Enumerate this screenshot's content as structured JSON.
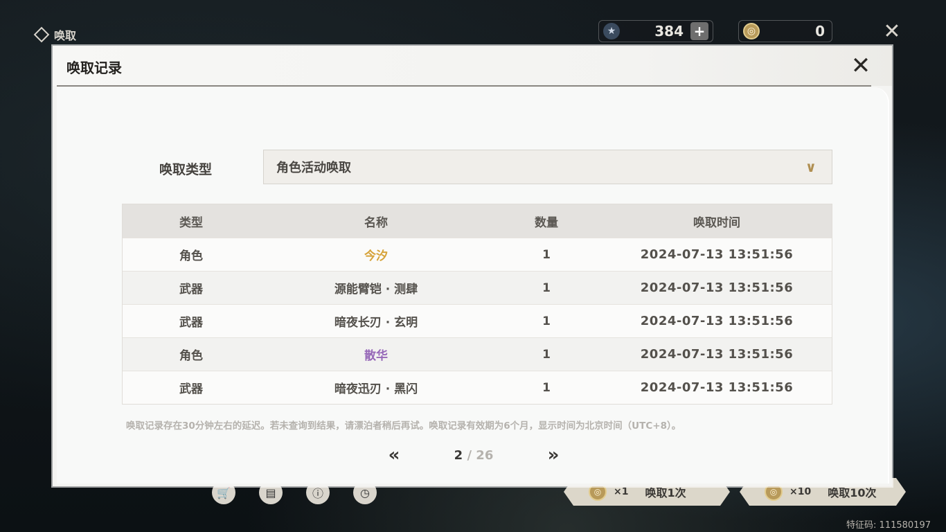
{
  "topbar": {
    "title": "唤取",
    "currency_star_value": "384",
    "currency_coin_value": "0"
  },
  "modal": {
    "title": "唤取记录",
    "filter_label": "唤取类型",
    "filter_selected": "角色活动唤取",
    "columns": [
      "类型",
      "名称",
      "数量",
      "唤取时间"
    ],
    "rows": [
      {
        "type": "角色",
        "name": "今汐",
        "qty": "1",
        "time": "2024-07-13 13:51:56",
        "quality": "gold"
      },
      {
        "type": "武器",
        "name": "源能臂铠 · 测肆",
        "qty": "1",
        "time": "2024-07-13 13:51:56",
        "quality": "normal"
      },
      {
        "type": "武器",
        "name": "暗夜长刃 · 玄明",
        "qty": "1",
        "time": "2024-07-13 13:51:56",
        "quality": "normal"
      },
      {
        "type": "角色",
        "name": "散华",
        "qty": "1",
        "time": "2024-07-13 13:51:56",
        "quality": "purple"
      },
      {
        "type": "武器",
        "name": "暗夜迅刃 · 黑闪",
        "qty": "1",
        "time": "2024-07-13 13:51:56",
        "quality": "normal"
      }
    ],
    "notice": "唤取记录存在30分钟左右的延迟。若未查询到结果，请漂泊者稍后再试。唤取记录有效期为6个月，显示时间为北京时间（UTC+8）。",
    "pager": {
      "current": "2",
      "separator": "/",
      "total": "26"
    }
  },
  "bottom": {
    "pull1_count": "×1",
    "pull1_label": "唤取1次",
    "pull10_count": "×10",
    "pull10_label": "唤取10次",
    "feature_code": "特征码: 111580197"
  },
  "colors": {
    "gold_quality": "#d6a33a",
    "purple_quality": "#9668b8",
    "accent_chevron": "#b08f52"
  }
}
